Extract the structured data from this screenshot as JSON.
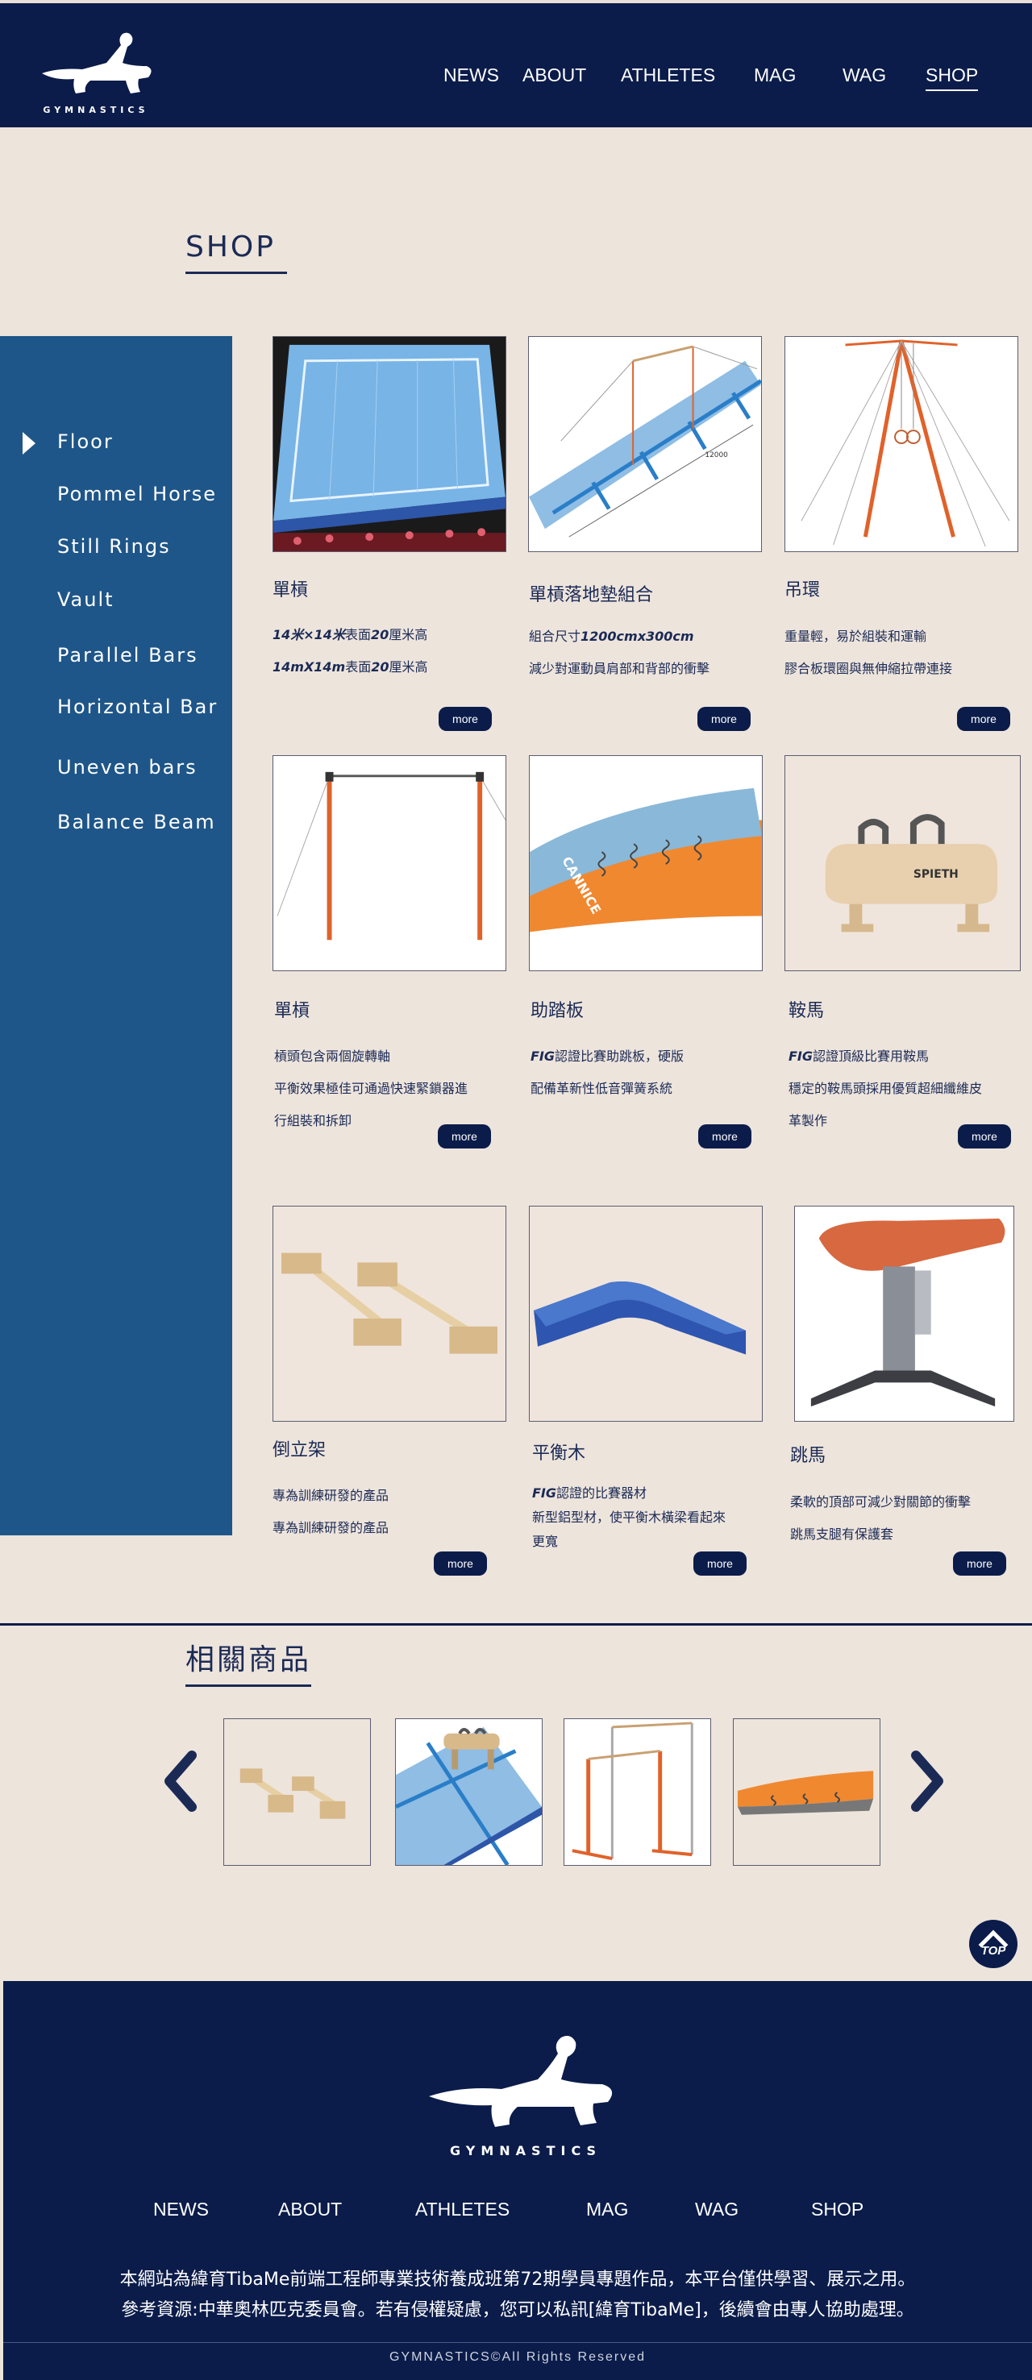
{
  "header": {
    "logo_text": "GYMNASTICS",
    "nav": [
      {
        "label": "NEWS"
      },
      {
        "label": "ABOUT"
      },
      {
        "label": "ATHLETES"
      },
      {
        "label": "MAG"
      },
      {
        "label": "WAG"
      },
      {
        "label": "SHOP",
        "active": true
      }
    ]
  },
  "page_title": "SHOP",
  "sidebar": {
    "items": [
      {
        "label": "Floor",
        "active": true
      },
      {
        "label": "Pommel Horse"
      },
      {
        "label": "Still Rings"
      },
      {
        "label": "Vault"
      },
      {
        "label": "Parallel Bars"
      },
      {
        "label": "Horizontal Bar"
      },
      {
        "label": "Uneven bars"
      },
      {
        "label": "Balance Beam"
      }
    ]
  },
  "products": [
    {
      "name": "單槓",
      "lines": [
        {
          "em": "14米×14米",
          "text": "表面",
          "em2": "20",
          "text2": "厘米高"
        },
        {
          "em": "14mX14m",
          "text": "表面",
          "em2": "20",
          "text2": "厘米高"
        }
      ],
      "more": "more",
      "image": "floor-mat"
    },
    {
      "name": "單槓落地墊組合",
      "lines": [
        {
          "text": "組合尺寸",
          "em": "1200cmx300cm"
        },
        {
          "text": "減少對運動員肩部和背部的衝擊"
        }
      ],
      "more": "more",
      "image": "landing-mats"
    },
    {
      "name": "吊環",
      "lines": [
        {
          "text": "重量輕，易於組裝和運輸"
        },
        {
          "text": "膠合板環圈與無伸縮拉帶連接"
        }
      ],
      "more": "more",
      "image": "rings"
    },
    {
      "name": "單槓",
      "lines": [
        {
          "text": "槓頭包含兩個旋轉軸"
        },
        {
          "text": "平衡效果極佳可通過快速緊鎖器進"
        },
        {
          "text": "行組裝和拆卸"
        }
      ],
      "more": "more",
      "image": "horizontal-bar"
    },
    {
      "name": "助踏板",
      "lines": [
        {
          "em": "FIG",
          "text": "認證比賽助跳板，硬版"
        },
        {
          "text": "配備革新性低音彈簧系統"
        }
      ],
      "more": "more",
      "image": "springboard"
    },
    {
      "name": "鞍馬",
      "lines": [
        {
          "em": "FIG",
          "text": "認證頂級比賽用鞍馬"
        },
        {
          "text": "穩定的鞍馬頭採用優質超細纖維皮"
        },
        {
          "text": "革製作"
        }
      ],
      "more": "more",
      "image": "pommel-horse"
    },
    {
      "name": "倒立架",
      "lines": [
        {
          "text": "專為訓練研發的產品"
        },
        {
          "text": "專為訓練研發的產品"
        }
      ],
      "more": "more",
      "image": "parallettes"
    },
    {
      "name": "平衡木",
      "lines": [
        {
          "em": "FIG",
          "text": "認證的比賽器材"
        },
        {
          "text": "新型鋁型材，使平衡木橫梁看起來"
        },
        {
          "text": "更寬"
        }
      ],
      "more": "more",
      "image": "beam-mat"
    },
    {
      "name": "跳馬",
      "lines": [
        {
          "text": "柔軟的頂部可減少對關節的衝擊"
        },
        {
          "text": "跳馬支腿有保護套"
        }
      ],
      "more": "more",
      "image": "vault"
    }
  ],
  "related": {
    "title": "相關商品",
    "items": [
      {
        "image": "parallettes"
      },
      {
        "image": "pommel-on-mat"
      },
      {
        "image": "uneven-bars"
      },
      {
        "image": "springboard"
      }
    ]
  },
  "top_button": "TOP",
  "footer": {
    "logo_text": "GYMNASTICS",
    "nav": [
      {
        "label": "NEWS"
      },
      {
        "label": "ABOUT"
      },
      {
        "label": "ATHLETES"
      },
      {
        "label": "MAG"
      },
      {
        "label": "WAG"
      },
      {
        "label": "SHOP"
      }
    ],
    "line1": "本網站為緯育TibaMe前端工程師專業技術養成班第72期學員專題作品，本平台僅供學習、展示之用。",
    "line2": "參考資源:中華奧林匹克委員會。若有侵權疑慮，您可以私訊[緯育TibaMe]，後續會由專人協助處理。",
    "copyright": "GYMNASTICS©All Rights Reserved"
  },
  "colors": {
    "navy": "#0b1c4a",
    "sidebar_blue": "#1f5689",
    "background": "#ede4dc",
    "orange": "#e0622a",
    "mat_blue": "#7fb2de"
  }
}
